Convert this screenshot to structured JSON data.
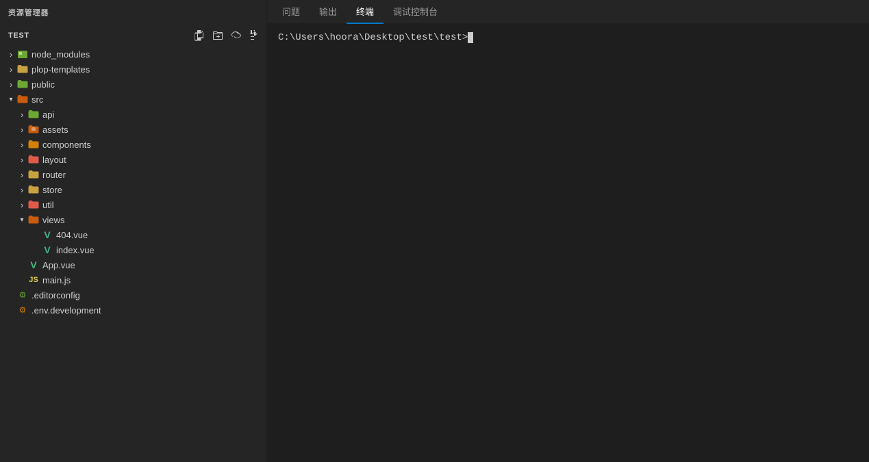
{
  "sidebar": {
    "title": "资源管理器",
    "project": {
      "name": "TEST"
    },
    "actions": [
      {
        "label": "新建文件",
        "icon": "new-file-icon"
      },
      {
        "label": "新建文件夹",
        "icon": "new-folder-icon"
      },
      {
        "label": "刷新",
        "icon": "refresh-icon"
      },
      {
        "label": "折叠",
        "icon": "collapse-icon"
      }
    ],
    "tree": [
      {
        "id": "node_modules",
        "label": "node_modules",
        "type": "folder",
        "indent": 0,
        "expanded": false,
        "icon": "node-modules-icon"
      },
      {
        "id": "plop_templates",
        "label": "plop-templates",
        "type": "folder",
        "indent": 0,
        "expanded": false,
        "icon": "folder-generic-icon"
      },
      {
        "id": "public",
        "label": "public",
        "type": "folder",
        "indent": 0,
        "expanded": false,
        "icon": "folder-public-icon"
      },
      {
        "id": "src",
        "label": "src",
        "type": "folder",
        "indent": 0,
        "expanded": true,
        "icon": "folder-src-icon"
      },
      {
        "id": "api",
        "label": "api",
        "type": "folder",
        "indent": 1,
        "expanded": false,
        "icon": "folder-api-icon"
      },
      {
        "id": "assets",
        "label": "assets",
        "type": "folder",
        "indent": 1,
        "expanded": false,
        "icon": "folder-assets-icon"
      },
      {
        "id": "components",
        "label": "components",
        "type": "folder",
        "indent": 1,
        "expanded": false,
        "icon": "folder-components-icon"
      },
      {
        "id": "layout",
        "label": "layout",
        "type": "folder",
        "indent": 1,
        "expanded": false,
        "icon": "folder-layout-icon"
      },
      {
        "id": "router",
        "label": "router",
        "type": "folder",
        "indent": 1,
        "expanded": false,
        "icon": "folder-router-icon"
      },
      {
        "id": "store",
        "label": "store",
        "type": "folder",
        "indent": 1,
        "expanded": false,
        "icon": "folder-store-icon"
      },
      {
        "id": "util",
        "label": "util",
        "type": "folder",
        "indent": 1,
        "expanded": false,
        "icon": "folder-util-icon"
      },
      {
        "id": "views",
        "label": "views",
        "type": "folder",
        "indent": 1,
        "expanded": true,
        "icon": "folder-views-icon"
      },
      {
        "id": "404vue",
        "label": "404.vue",
        "type": "file-vue",
        "indent": 2,
        "expanded": false,
        "icon": "vue-icon"
      },
      {
        "id": "indexvue",
        "label": "index.vue",
        "type": "file-vue",
        "indent": 2,
        "expanded": false,
        "icon": "vue-icon"
      },
      {
        "id": "appvue",
        "label": "App.vue",
        "type": "file-vue",
        "indent": 1,
        "expanded": false,
        "icon": "vue-icon"
      },
      {
        "id": "mainjs",
        "label": "main.js",
        "type": "file-js",
        "indent": 1,
        "expanded": false,
        "icon": "js-icon"
      },
      {
        "id": "editorconfig",
        "label": ".editorconfig",
        "type": "file-config",
        "indent": 0,
        "expanded": false,
        "icon": "editorconfig-icon"
      },
      {
        "id": "envdevelopment",
        "label": ".env.development",
        "type": "file-env",
        "indent": 0,
        "expanded": false,
        "icon": "env-icon"
      }
    ]
  },
  "panel": {
    "tabs": [
      {
        "id": "problems",
        "label": "问题",
        "active": false
      },
      {
        "id": "output",
        "label": "输出",
        "active": false
      },
      {
        "id": "terminal",
        "label": "终端",
        "active": true
      },
      {
        "id": "debug_console",
        "label": "调试控制台",
        "active": false
      }
    ]
  },
  "terminal": {
    "prompt": "C:\\Users\\hoora\\Desktop\\test\\test>"
  }
}
